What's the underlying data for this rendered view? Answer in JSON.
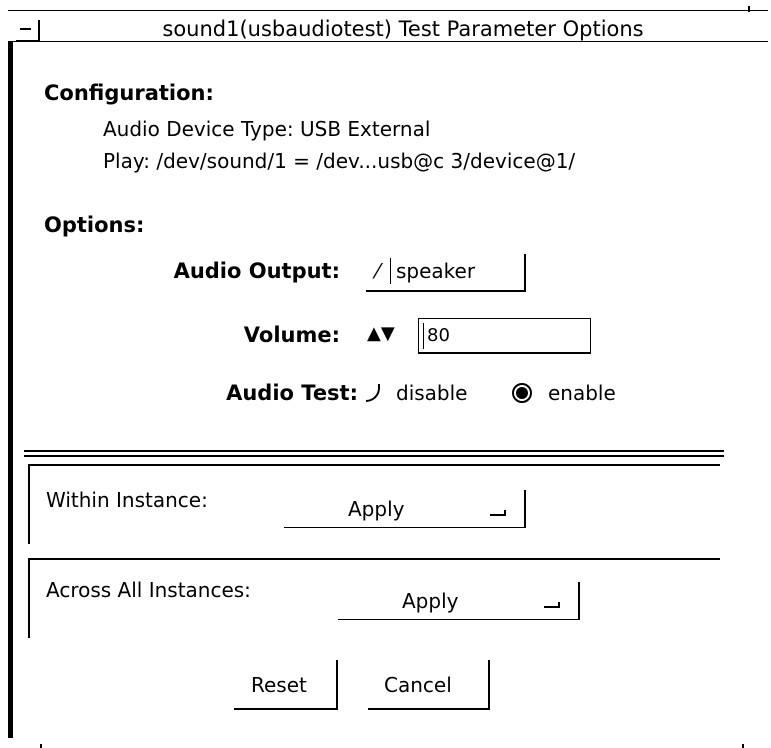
{
  "window": {
    "title": "sound1(usbaudiotest) Test Parameter Options"
  },
  "configuration": {
    "heading": "Configuration:",
    "device_type": "Audio Device Type:  USB External",
    "play": "Play:   /dev/sound/1 = /dev...usb@c 3/device@1/"
  },
  "options": {
    "heading": "Options:",
    "audio_output": {
      "label": "Audio Output:",
      "value": "speaker"
    },
    "volume": {
      "label": "Volume:",
      "arrows": "▲▼",
      "value": "80"
    },
    "audio_test": {
      "label": "Audio Test:",
      "disable_label": "disable",
      "enable_label": "enable",
      "selected": "enable"
    }
  },
  "within_instance": {
    "label": "Within Instance:",
    "button": "Apply"
  },
  "across_instances": {
    "label": "Across All Instances:",
    "button": "Apply"
  },
  "buttons": {
    "reset": "Reset",
    "cancel": "Cancel"
  }
}
